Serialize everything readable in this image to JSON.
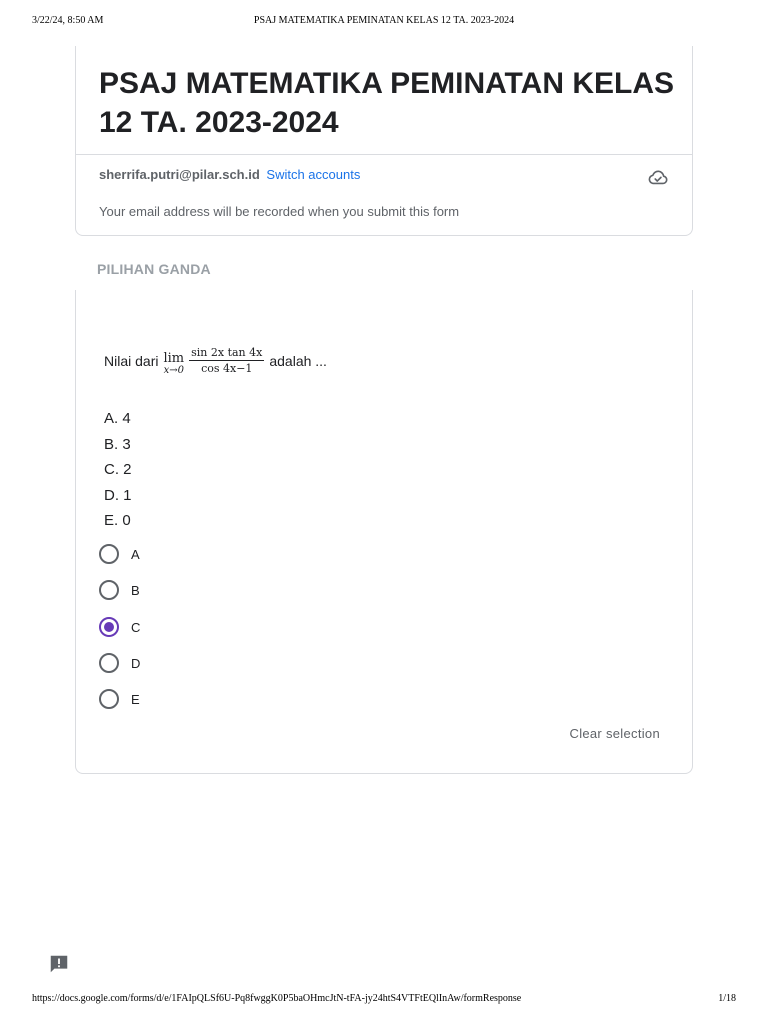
{
  "print": {
    "datetime": "3/22/24, 8:50 AM",
    "doc_title": "PSAJ MATEMATIKA PEMINATAN KELAS 12 TA. 2023-2024",
    "url": "https://docs.google.com/forms/d/e/1FAIpQLSf6U-Pq8fwggK0P5baOHmcJtN-tFA-jy24htS4VTFtEQlInAw/formResponse",
    "page": "1/18"
  },
  "form": {
    "title": "PSAJ MATEMATIKA PEMINATAN KELAS 12 TA. 2023-2024",
    "account_email": "sherrifa.putri@pilar.sch.id",
    "switch_label": "Switch accounts",
    "record_note": "Your email address will be recorded when you submit this form",
    "cloud_icon": "cloud-saved-icon"
  },
  "section": {
    "title": "PILIHAN GANDA"
  },
  "question": {
    "prefix": "Nilai dari",
    "lim": "lim",
    "lim_sub": "x→0",
    "numerator": "sin 2x tan 4x",
    "denominator": "cos 4x−1",
    "suffix": "adalah ...",
    "options_text": [
      "A. 4",
      "B. 3",
      "C. 2",
      "D. 1",
      "E. 0"
    ],
    "choices": [
      "A",
      "B",
      "C",
      "D",
      "E"
    ],
    "selected": "C",
    "clear_label": "Clear selection"
  },
  "colors": {
    "accent": "#673ab7",
    "link": "#1a73e8",
    "muted": "#5f6368",
    "border": "#dadce0"
  },
  "feedback_icon": "feedback-icon"
}
